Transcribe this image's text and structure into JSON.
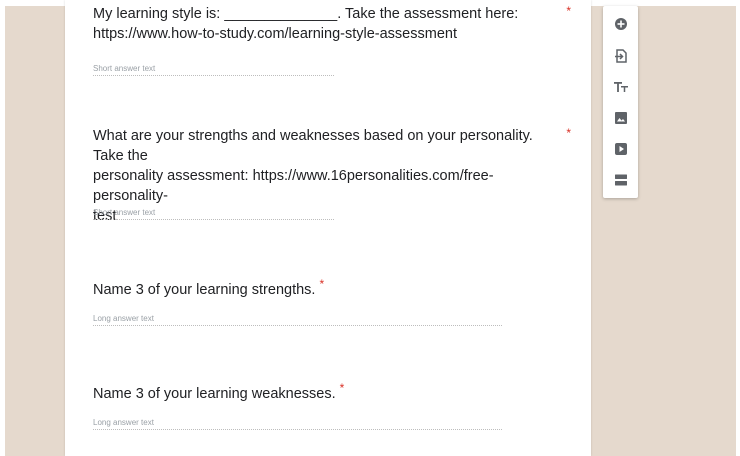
{
  "questions": [
    {
      "title_lines": [
        "My learning style is: ______________. Take the assessment here:",
        "https://www.how-to-study.com/learning-style-assessment"
      ],
      "required": "*",
      "placeholder": "Short answer text"
    },
    {
      "title_lines": [
        "What are your strengths and weaknesses based on your personality. Take the",
        "personality assessment: https://www.16personalities.com/free-personality-",
        "test"
      ],
      "required": "*",
      "placeholder": "Short answer text"
    },
    {
      "title": "Name 3 of your learning strengths.",
      "required": "*",
      "placeholder": "Long answer text"
    },
    {
      "title": "Name 3 of your learning weaknesses.",
      "required": "*",
      "placeholder": "Long answer text"
    }
  ],
  "toolbar": {
    "icons": [
      "add-question-icon",
      "import-questions-icon",
      "title-text-icon",
      "image-icon",
      "video-icon",
      "section-icon"
    ],
    "icon_color": "#5f6368"
  },
  "colors": {
    "background": "#e5d9cd",
    "required": "#d93025"
  }
}
